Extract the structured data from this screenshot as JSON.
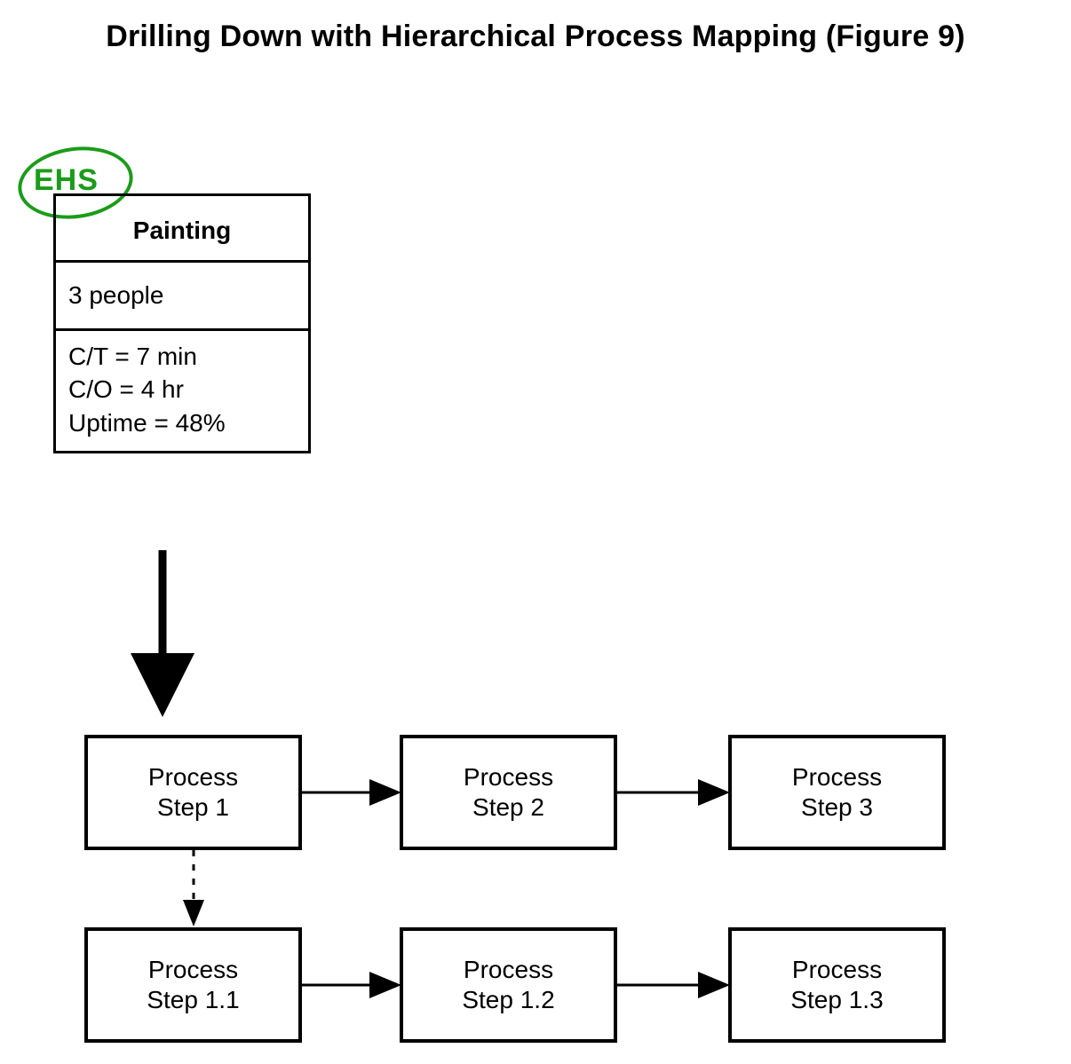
{
  "title": "Drilling Down with Hierarchical Process Mapping (Figure 9)",
  "ehs_label": "EHS",
  "main_box": {
    "header": "Painting",
    "people": "3 people",
    "metrics": {
      "ct": "C/T = 7 min",
      "co": "C/O = 4 hr",
      "uptime": "Uptime = 48%"
    }
  },
  "steps_row1": {
    "s1": "Process\nStep 1",
    "s2": "Process\nStep 2",
    "s3": "Process\nStep 3"
  },
  "steps_row2": {
    "s11": "Process\nStep 1.1",
    "s12": "Process\nStep 1.2",
    "s13": "Process\nStep 1.3"
  }
}
